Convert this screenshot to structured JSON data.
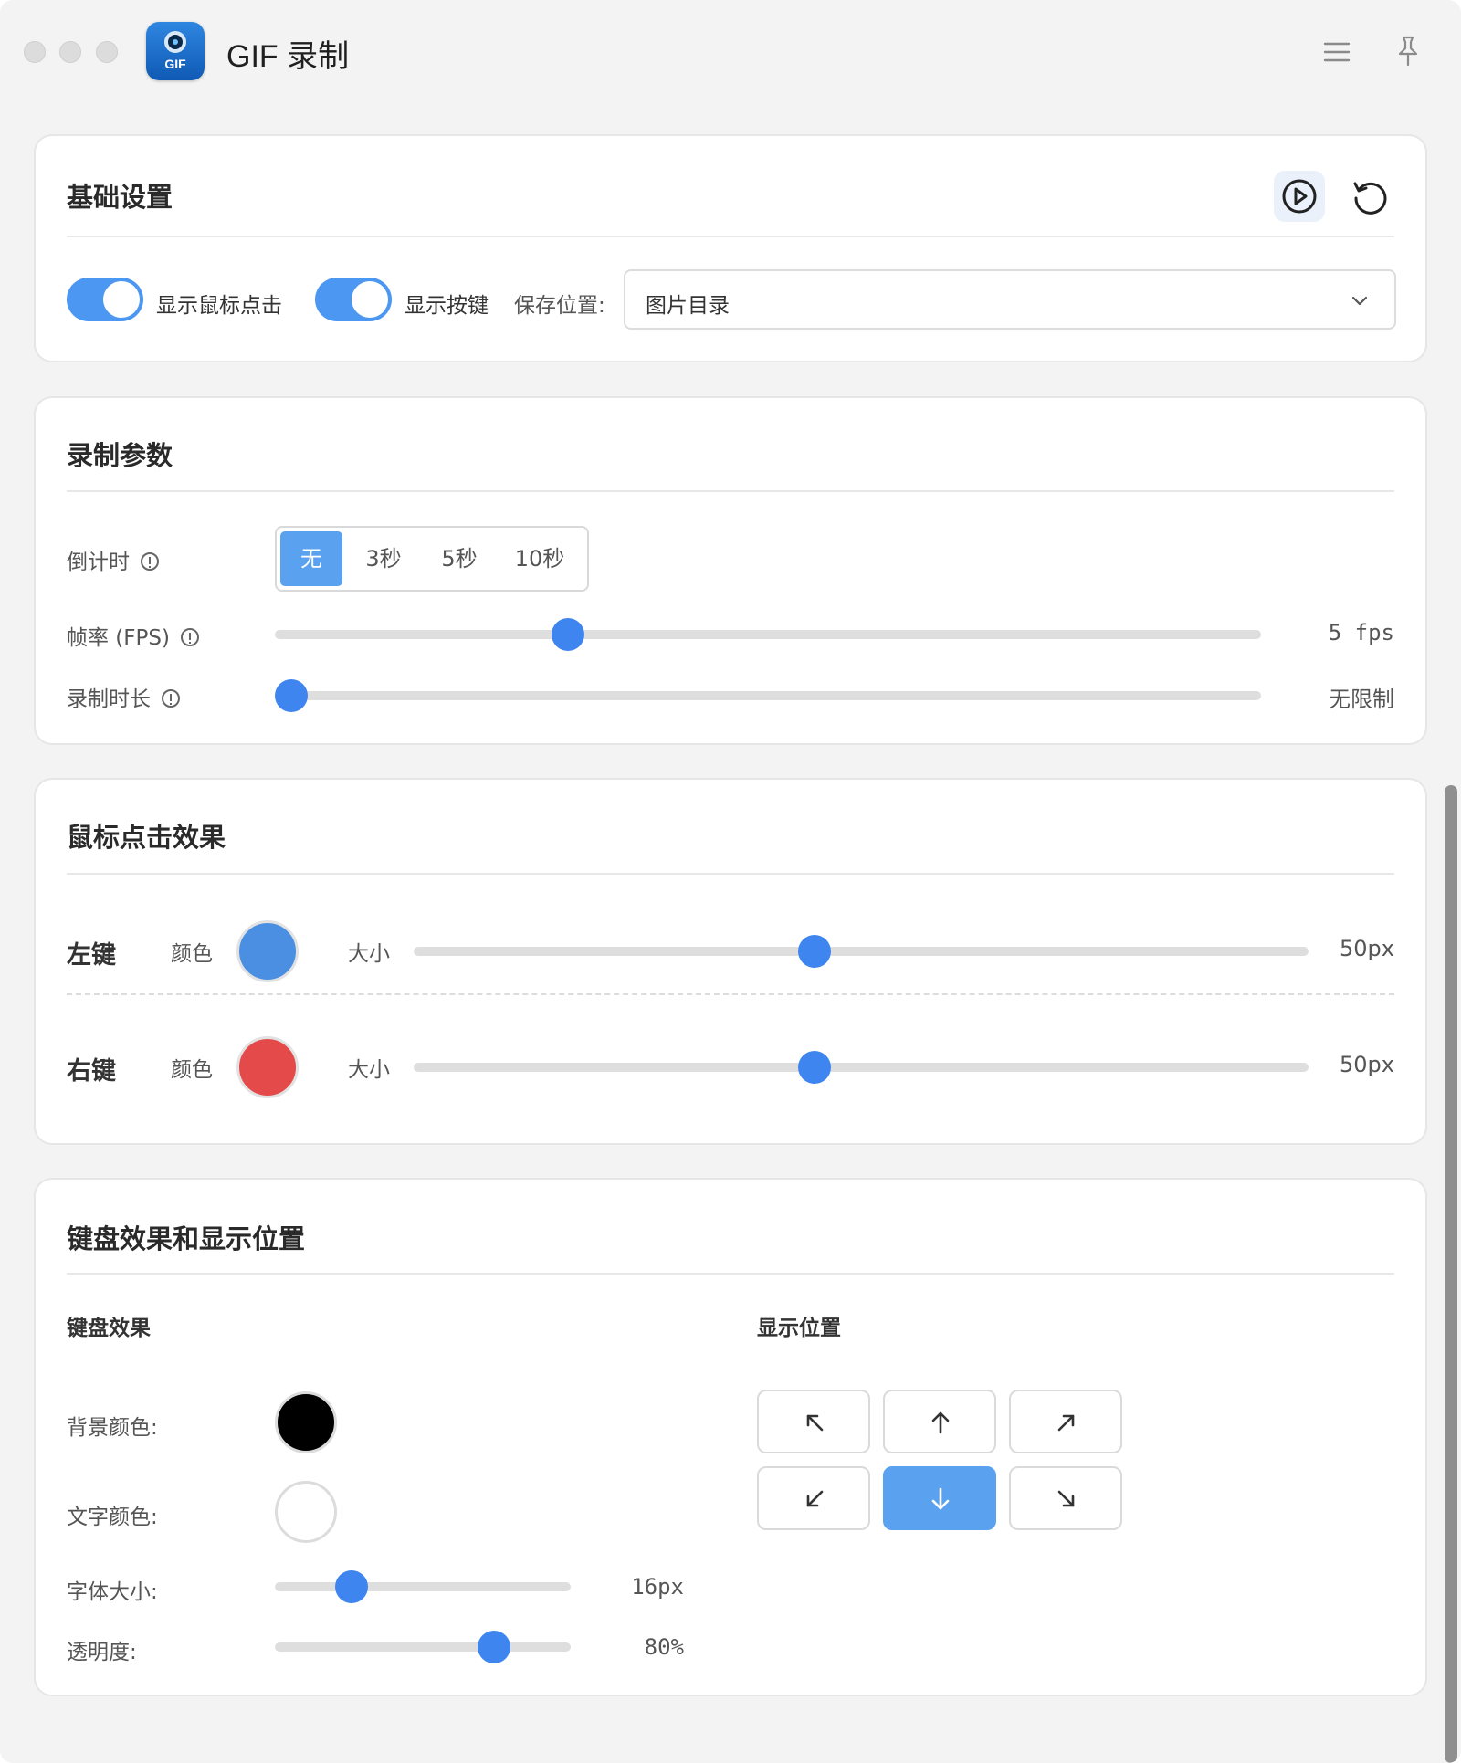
{
  "window": {
    "title": "GIF 录制",
    "app_icon_text": "GIF"
  },
  "basic": {
    "title": "基础设置",
    "toggle_mouse_label": "显示鼠标点击",
    "toggle_mouse_on": true,
    "toggle_keys_label": "显示按键",
    "toggle_keys_on": true,
    "save_label": "保存位置:",
    "save_value": "图片目录"
  },
  "record": {
    "title": "录制参数",
    "countdown_label": "倒计时",
    "countdown_options": [
      "无",
      "3秒",
      "5秒",
      "10秒"
    ],
    "countdown_selected": "无",
    "fps_label": "帧率 (FPS)",
    "fps_value": "5 fps",
    "fps_fraction": 0.29,
    "duration_label": "录制时长",
    "duration_value": "无限制",
    "duration_fraction": 0.0
  },
  "mouse": {
    "title": "鼠标点击效果",
    "left": {
      "label": "左键",
      "color_label": "颜色",
      "color": "#4a8fe2",
      "size_label": "大小",
      "size_value": "50px",
      "size_fraction": 0.446
    },
    "right": {
      "label": "右键",
      "color_label": "颜色",
      "color": "#e44a4a",
      "size_label": "大小",
      "size_value": "50px",
      "size_fraction": 0.446
    }
  },
  "keyboard": {
    "title": "键盘效果和显示位置",
    "effects_heading": "键盘效果",
    "bg_color_label": "背景颜色:",
    "bg_color": "#000000",
    "text_color_label": "文字颜色:",
    "text_color": "#ffffff",
    "font_size_label": "字体大小:",
    "font_size_value": "16px",
    "font_size_fraction": 0.23,
    "opacity_label": "透明度:",
    "opacity_value": "80%",
    "opacity_fraction": 0.77,
    "position_heading": "显示位置",
    "positions": [
      "top-left",
      "top",
      "top-right",
      "bottom-left",
      "bottom",
      "bottom-right"
    ],
    "position_selected": "bottom"
  },
  "colors": {
    "accent": "#3f85ef",
    "accent_light": "#5aa2ef"
  }
}
